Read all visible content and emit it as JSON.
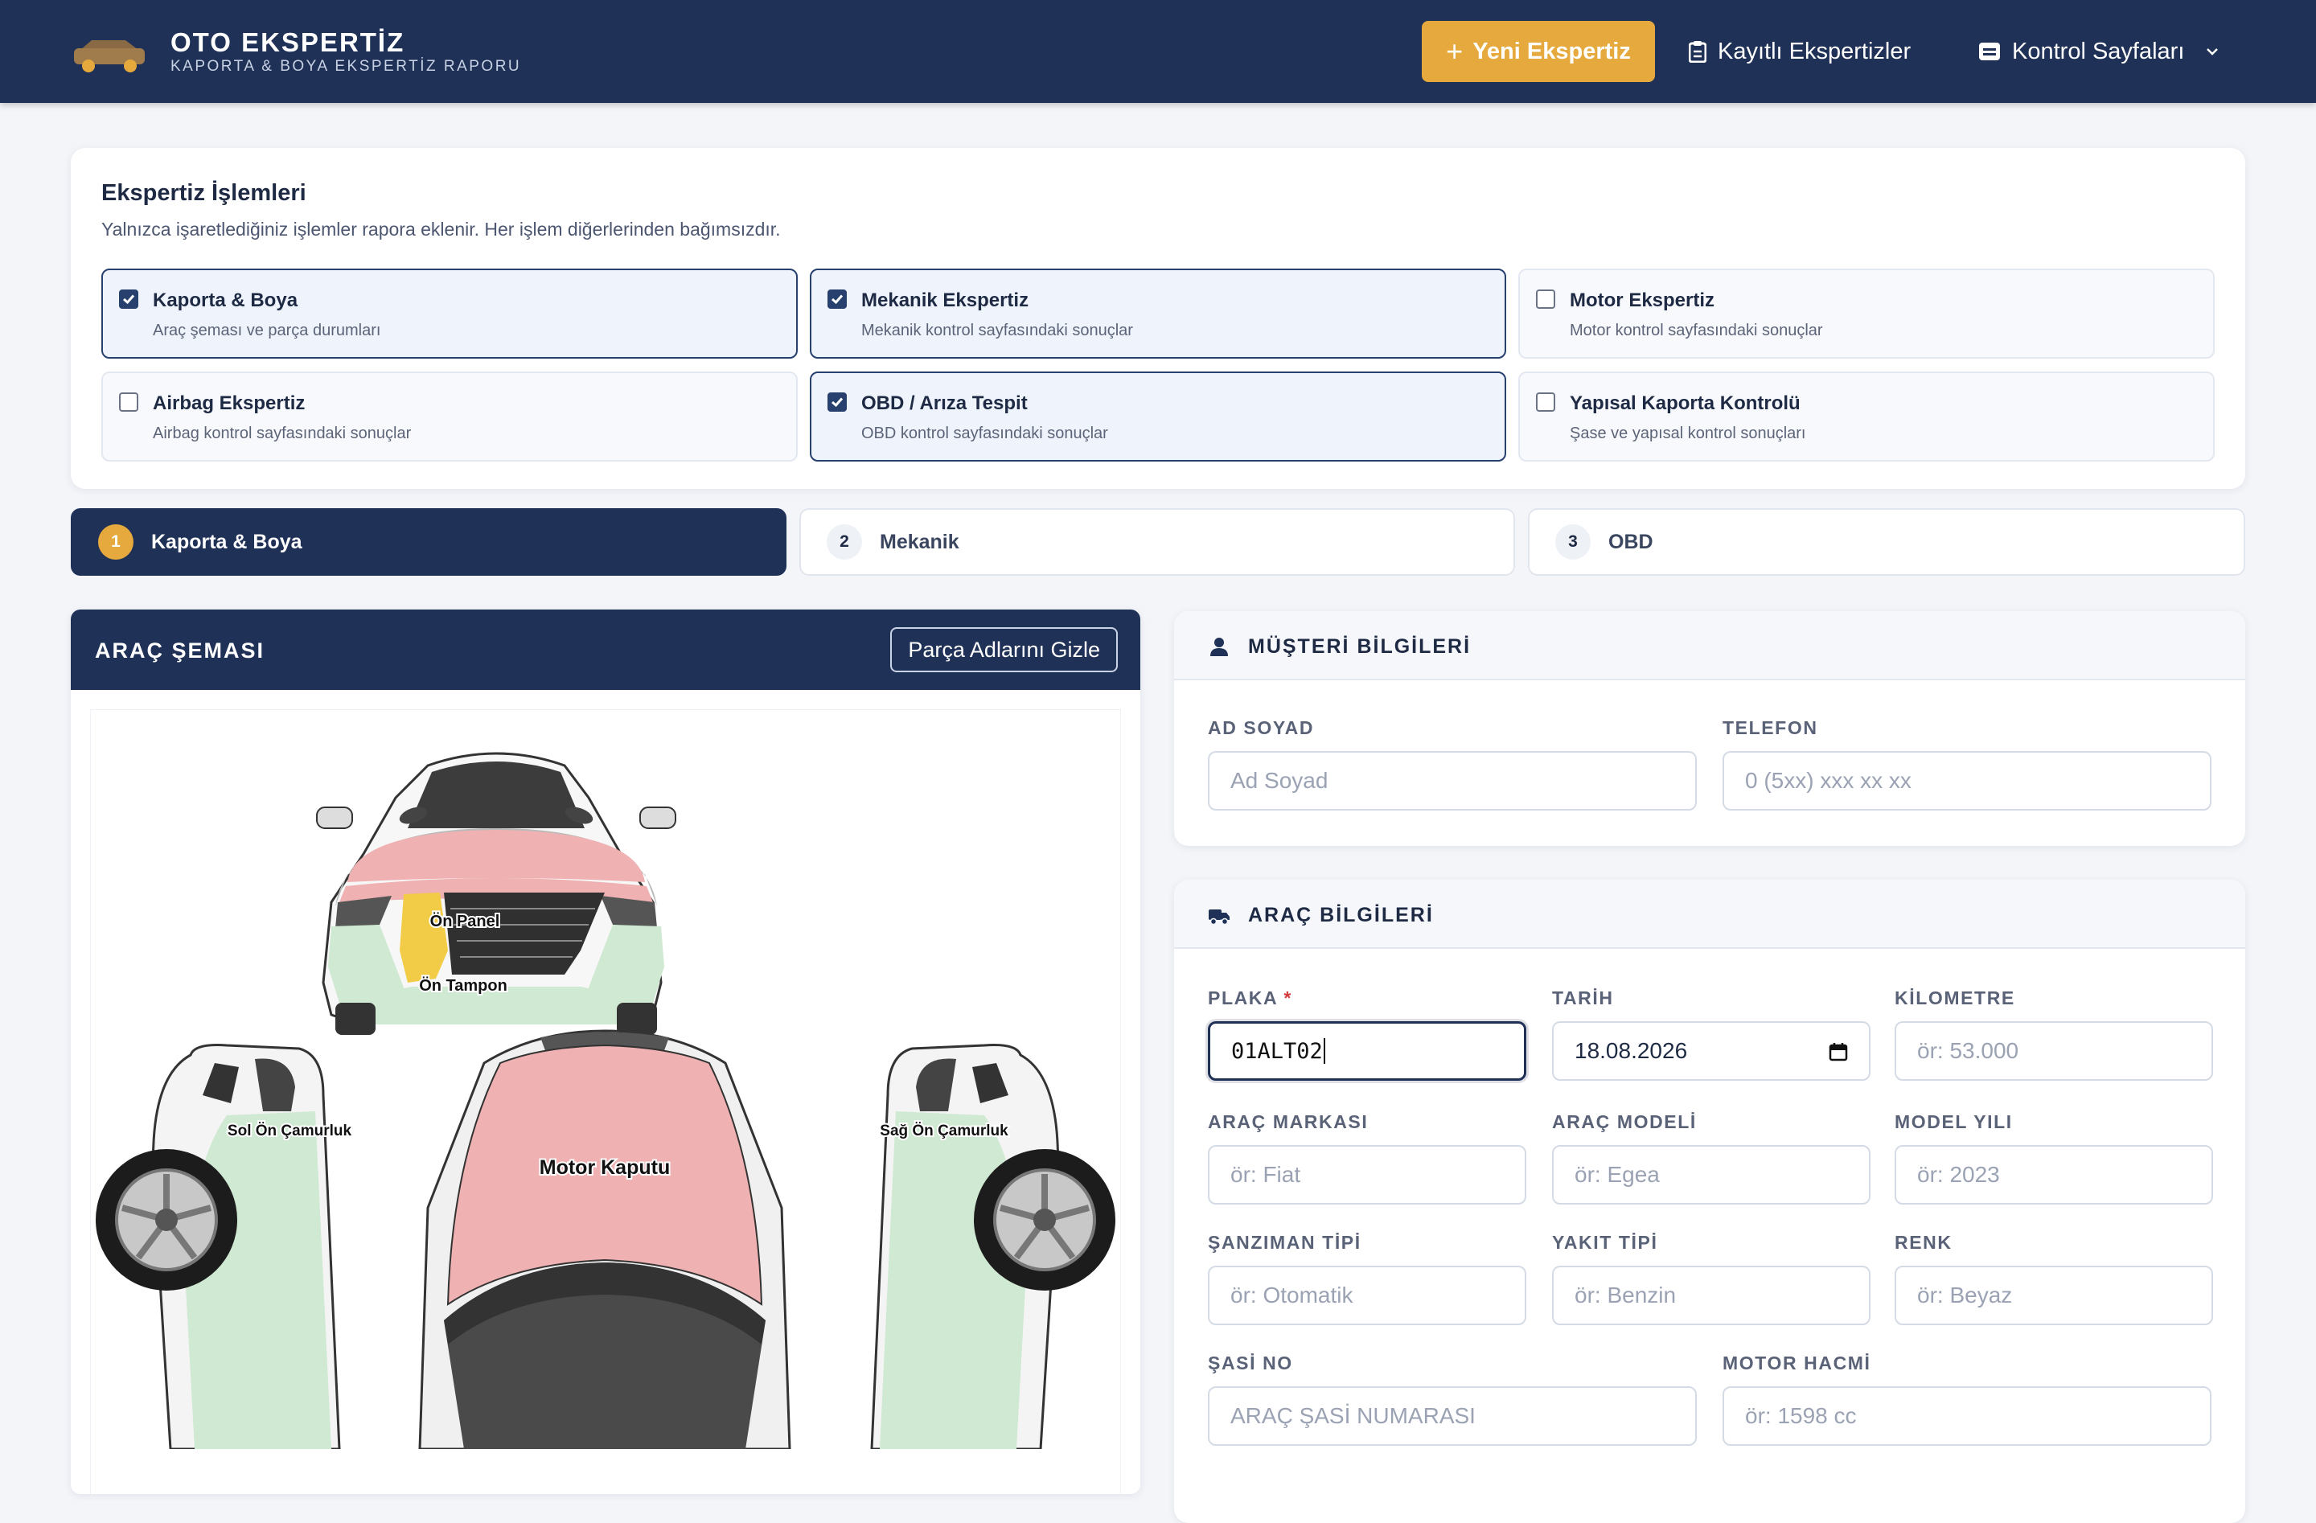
{
  "app": {
    "title": "OTO EKSPERTİZ",
    "subtitle": "KAPORTA & BOYA EKSPERTİZ RAPORU"
  },
  "nav": {
    "new_label": "Yeni Ekspertiz",
    "saved_label": "Kayıtlı Ekspertizler",
    "control_label": "Kontrol Sayfaları"
  },
  "operations": {
    "title": "Ekspertiz İşlemleri",
    "subtitle": "Yalnızca işaretlediğiniz işlemler rapora eklenir. Her işlem diğerlerinden bağımsızdır.",
    "items": [
      {
        "label": "Kaporta & Boya",
        "desc": "Araç şeması ve parça durumları",
        "checked": true
      },
      {
        "label": "Mekanik Ekspertiz",
        "desc": "Mekanik kontrol sayfasındaki sonuçlar",
        "checked": true
      },
      {
        "label": "Motor Ekspertiz",
        "desc": "Motor kontrol sayfasındaki sonuçlar",
        "checked": false
      },
      {
        "label": "Airbag Ekspertiz",
        "desc": "Airbag kontrol sayfasındaki sonuçlar",
        "checked": false
      },
      {
        "label": "OBD / Arıza Tespit",
        "desc": "OBD kontrol sayfasındaki sonuçlar",
        "checked": true
      },
      {
        "label": "Yapısal Kaporta Kontrolü",
        "desc": "Şase ve yapısal kontrol sonuçları",
        "checked": false
      }
    ]
  },
  "tabs": [
    {
      "num": "1",
      "label": "Kaporta & Boya",
      "active": true
    },
    {
      "num": "2",
      "label": "Mekanik",
      "active": false
    },
    {
      "num": "3",
      "label": "OBD",
      "active": false
    }
  ],
  "scheme": {
    "title": "ARAÇ ŞEMASI",
    "toggle_label": "Parça Adlarını Gizle",
    "parts": {
      "front_panel": "Ön Panel",
      "front_bumper": "Ön Tampon",
      "left_front_fender": "Sol Ön Çamurluk",
      "hood": "Motor Kaputu",
      "right_front_fender": "Sağ Ön Çamurluk"
    },
    "colors": {
      "painted": "#efb1b1",
      "replaced": "#f2cc46",
      "original": "#cfe9d2"
    }
  },
  "customer": {
    "title": "MÜŞTERİ BİLGİLERİ",
    "name_label": "AD SOYAD",
    "name_placeholder": "Ad Soyad",
    "phone_label": "TELEFON",
    "phone_placeholder": "0 (5xx) xxx xx xx"
  },
  "vehicle": {
    "title": "ARAÇ BİLGİLERİ",
    "plate_label": "PLAKA",
    "plate_required": "*",
    "plate_value": "01ALT02",
    "date_label": "TARİH",
    "date_value": "18.08.2026",
    "km_label": "KİLOMETRE",
    "km_placeholder": "ör: 53.000",
    "brand_label": "ARAÇ MARKASI",
    "brand_placeholder": "ör: Fiat",
    "model_label": "ARAÇ MODELİ",
    "model_placeholder": "ör: Egea",
    "year_label": "MODEL YILI",
    "year_placeholder": "ör: 2023",
    "gear_label": "ŞANZIMAN TİPİ",
    "gear_placeholder": "ör: Otomatik",
    "fuel_label": "YAKIT TİPİ",
    "fuel_placeholder": "ör: Benzin",
    "color_label": "RENK",
    "color_placeholder": "ör: Beyaz",
    "chassis_label": "ŞASİ NO",
    "chassis_placeholder": "ARAÇ ŞASİ NUMARASI",
    "engine_label": "MOTOR HACMİ",
    "engine_placeholder": "ör: 1598 cc"
  }
}
